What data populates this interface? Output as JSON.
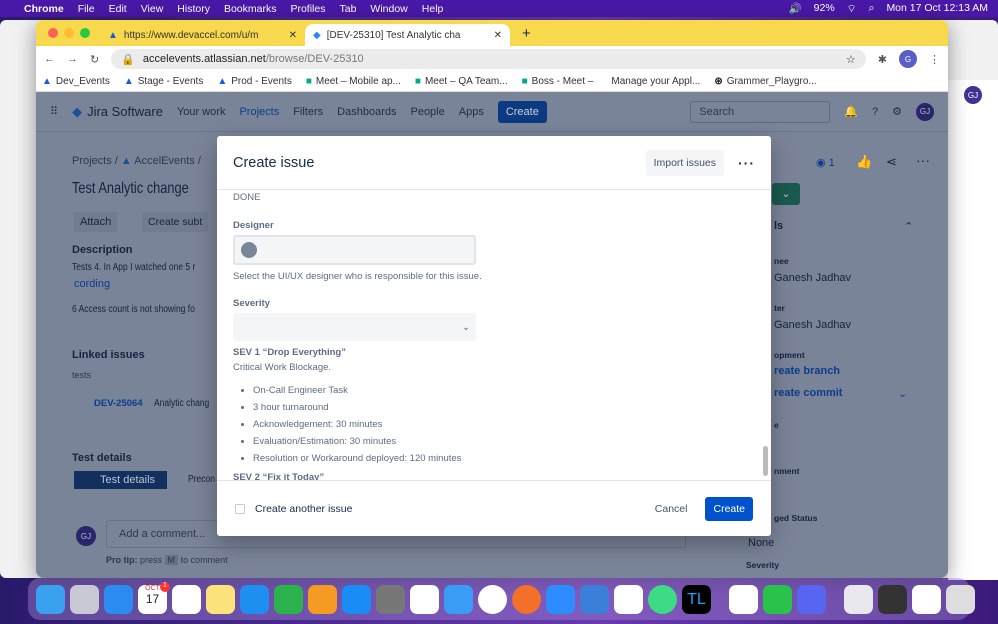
{
  "menubar": {
    "app": "Chrome",
    "items": [
      "File",
      "Edit",
      "View",
      "History",
      "Bookmarks",
      "Profiles",
      "Tab",
      "Window",
      "Help"
    ],
    "battery": "92%",
    "datetime": "Mon 17 Oct  12:13 AM"
  },
  "browser": {
    "tabs": [
      {
        "title": "https://www.devaccel.com/u/m"
      },
      {
        "title": "[DEV-25310] Test Analytic cha"
      }
    ],
    "url_host": "accelevents.atlassian.net",
    "url_path": "/browse/DEV-25310",
    "profile": "G",
    "bookmarks": [
      "Dev_Events",
      "Stage - Events",
      "Prod - Events",
      "Meet – Mobile ap...",
      "Meet – QA Team...",
      "Boss - Meet –",
      "Manage your Appl...",
      "Grammer_Playgro..."
    ]
  },
  "jira": {
    "logo": "Jira Software",
    "nav": [
      "Your work",
      "Projects",
      "Filters",
      "Dashboards",
      "People",
      "Apps"
    ],
    "create": "Create",
    "search_placeholder": "Search",
    "avatar": "GJ",
    "breadcrumb": [
      "Projects",
      "AccelEvents"
    ],
    "issue_title": "Test Analytic change",
    "attach": "Attach",
    "create_subtask": "Create subt",
    "description_label": "Description",
    "description_line1": "Tests 4. In App I watched one 5 r",
    "description_tag": "cording",
    "description_line2": "6 Access count is not showing fo",
    "linked_issues": "Linked issues",
    "linked_type": "tests",
    "linked_key": "DEV-25064",
    "linked_summary": "Analytic chang",
    "test_details_heading": "Test details",
    "test_details_tab": "Test details",
    "precondition_tab": "Precon",
    "comment_placeholder": "Add a comment...",
    "pro_tip_bold": "Pro tip:",
    "pro_tip_press": "press",
    "pro_tip_key": "M",
    "pro_tip_rest": "to comment",
    "watch_count": "1",
    "details": "ls",
    "assignee_label": "nee",
    "assignee": "Ganesh Jadhav",
    "reporter_label": "ter",
    "reporter": "Ganesh Jadhav",
    "development_label": "opment",
    "create_branch": "reate branch",
    "create_commit": "reate commit",
    "field_e": "e",
    "environment_label": "nment",
    "status_label": "ged Status",
    "status_value": "None",
    "severity_label": "Severity"
  },
  "modal": {
    "title": "Create issue",
    "import": "Import issues",
    "done": "DONE",
    "designer_label": "Designer",
    "designer_help": "Select the UI/UX designer who is responsible for this issue.",
    "severity_label": "Severity",
    "sev1_title": "SEV 1  “Drop Everything”",
    "sev1_desc": "Critical Work Blockage.",
    "sev1_items": [
      "On-Call Engineer Task",
      "3 hour turnaround",
      "Acknowledgement: 30 minutes",
      "Evaluation/Estimation: 30 minutes",
      "Resolution or Workaround deployed: 120 minutes"
    ],
    "sev2_title": "SEV 2  “Fix it Today”",
    "create_another": "Create another issue",
    "cancel": "Cancel",
    "create": "Create"
  },
  "dock": {
    "calendar_month": "OCT",
    "calendar_day": "17",
    "calendar_badge": "1",
    "apps": [
      "finder",
      "launchpad",
      "mail",
      "calendar",
      "reminders",
      "notes",
      "keynote",
      "numbers",
      "pages",
      "app-store",
      "system-preferences",
      "slack",
      "safari",
      "chrome",
      "firefox",
      "zoom",
      "app",
      "vscode",
      "android-studio",
      "terminal-tl",
      "word",
      "facetime",
      "discord",
      "window",
      "window",
      "window",
      "trash"
    ],
    "tl_label": "TL"
  }
}
